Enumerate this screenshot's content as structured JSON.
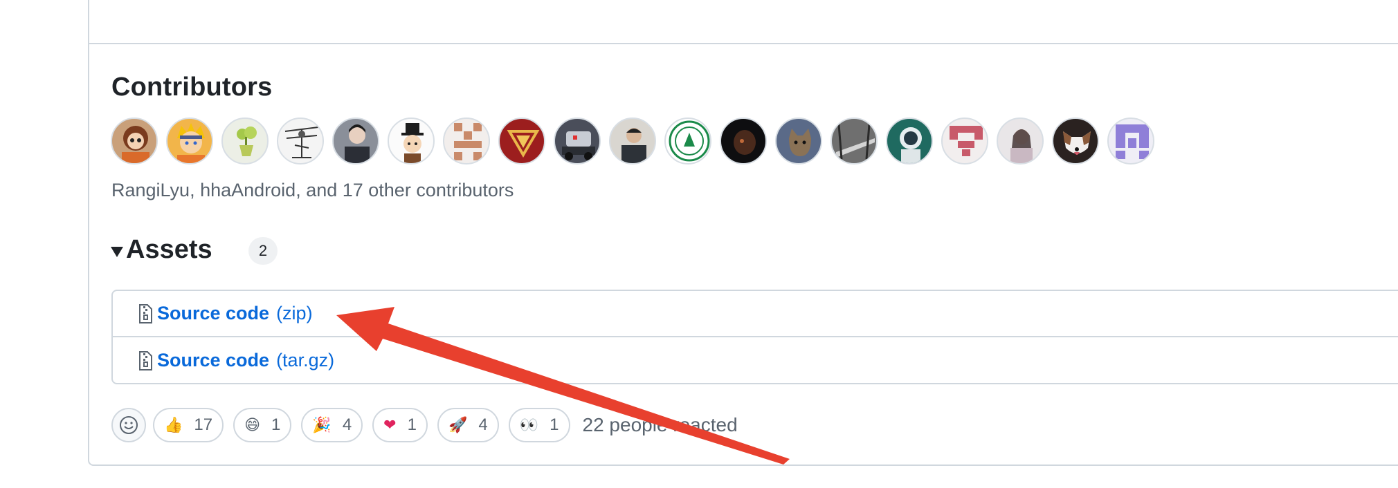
{
  "contributors": {
    "title": "Contributors",
    "summary": "RangiLyu, hhaAndroid, and 17 other contributors",
    "avatars": [
      "avatar-anime-girl",
      "avatar-cartoon-boy",
      "avatar-plant",
      "avatar-sketch",
      "avatar-person-dark",
      "avatar-cartoon-hat",
      "avatar-identicon-brown",
      "avatar-iron-logo",
      "avatar-robot",
      "avatar-person",
      "avatar-emblem-green",
      "avatar-dark-portrait",
      "avatar-cat",
      "avatar-bridge",
      "avatar-astronaut",
      "avatar-identicon-red",
      "avatar-person-light",
      "avatar-dog",
      "avatar-identicon-purple"
    ]
  },
  "assets": {
    "title": "Assets",
    "count": "2",
    "items": [
      {
        "name": "Source code",
        "ext": "(zip)"
      },
      {
        "name": "Source code",
        "ext": "(tar.gz)"
      }
    ]
  },
  "reactions": {
    "items": [
      {
        "emoji": "👍",
        "count": "17"
      },
      {
        "emoji": "😄",
        "count": "1"
      },
      {
        "emoji": "🎉",
        "count": "4"
      },
      {
        "emoji": "❤",
        "count": "1"
      },
      {
        "emoji": "🚀",
        "count": "4"
      },
      {
        "emoji": "👀",
        "count": "1"
      }
    ],
    "summary": "22 people reacted"
  },
  "colors": {
    "link": "#0969da",
    "annotation_arrow": "#e8402e",
    "border": "#d0d7de"
  }
}
